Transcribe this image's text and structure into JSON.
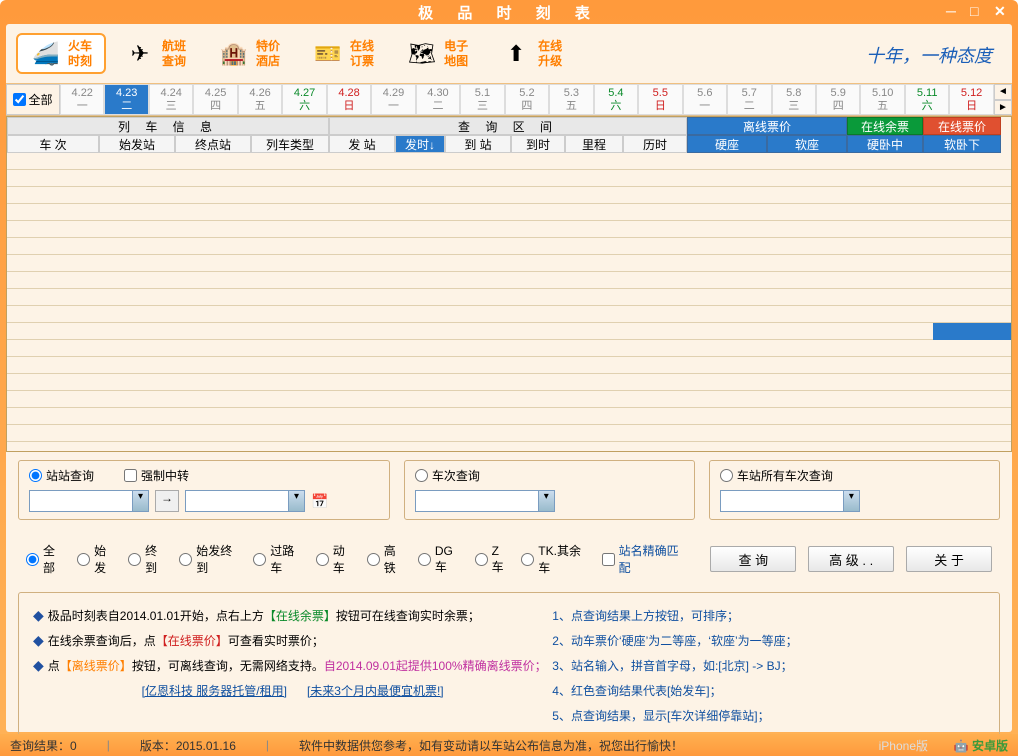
{
  "title": "极 品 时 刻 表",
  "nav": [
    {
      "l1": "火车",
      "l2": "时刻",
      "icon": "🚄"
    },
    {
      "l1": "航班",
      "l2": "查询",
      "icon": "✈"
    },
    {
      "l1": "特价",
      "l2": "酒店",
      "icon": "🏨"
    },
    {
      "l1": "在线",
      "l2": "订票",
      "icon": "🎫"
    },
    {
      "l1": "电子",
      "l2": "地图",
      "icon": "🗺"
    },
    {
      "l1": "在线",
      "l2": "升级",
      "icon": "⬆"
    }
  ],
  "slogan": "十年，一种态度",
  "date_all": "全部",
  "dates": [
    {
      "d": "4.22",
      "w": "一"
    },
    {
      "d": "4.23",
      "w": "二",
      "active": true
    },
    {
      "d": "4.24",
      "w": "三"
    },
    {
      "d": "4.25",
      "w": "四"
    },
    {
      "d": "4.26",
      "w": "五"
    },
    {
      "d": "4.27",
      "w": "六",
      "sat": true
    },
    {
      "d": "4.28",
      "w": "日",
      "sun": true
    },
    {
      "d": "4.29",
      "w": "一"
    },
    {
      "d": "4.30",
      "w": "二"
    },
    {
      "d": "5.1",
      "w": "三"
    },
    {
      "d": "5.2",
      "w": "四"
    },
    {
      "d": "5.3",
      "w": "五"
    },
    {
      "d": "5.4",
      "w": "六",
      "sat": true
    },
    {
      "d": "5.5",
      "w": "日",
      "sun": true
    },
    {
      "d": "5.6",
      "w": "一"
    },
    {
      "d": "5.7",
      "w": "二"
    },
    {
      "d": "5.8",
      "w": "三"
    },
    {
      "d": "5.9",
      "w": "四"
    },
    {
      "d": "5.10",
      "w": "五"
    },
    {
      "d": "5.11",
      "w": "六",
      "sat": true
    },
    {
      "d": "5.12",
      "w": "日",
      "sun": true
    }
  ],
  "hgroup": {
    "a": "列 车 信 息",
    "b": "查 询 区 间",
    "c": "离线票价",
    "d": "在线余票",
    "e": "在线票价"
  },
  "cols": {
    "c1": "车 次",
    "c2": "始发站",
    "c3": "终点站",
    "c4": "列车类型",
    "c5": "发 站",
    "c6": "发时↓",
    "c7": "到 站",
    "c8": "到时",
    "c9": "里程",
    "c10": "历时",
    "c11": "硬座",
    "c12": "软座",
    "c13": "硬卧中",
    "c14": "软卧下"
  },
  "q1": {
    "r1": "站站查询",
    "chk": "强制中转"
  },
  "q2": {
    "r1": "车次查询"
  },
  "q3": {
    "r1": "车站所有车次查询"
  },
  "filters": {
    "all": "全部",
    "sf": "始发",
    "zd": "终到",
    "sfzd": "始发终到",
    "glc": "过路车",
    "dc": "动车",
    "gt": "高铁",
    "dgc": "DG车",
    "zc": "Z车",
    "tk": "TK.其余车",
    "jq": "站名精确匹配"
  },
  "buttons": {
    "query": "查 询",
    "adv": "高 级 . .",
    "about": "关 于"
  },
  "info_left": {
    "l1a": "极品时刻表自2014.01.01开始，点右上方",
    "l1b": "【在线余票】",
    "l1c": "按钮可在线查询实时余票；",
    "l2a": "在线余票查询后，点",
    "l2b": "【在线票价】",
    "l2c": "可查看实时票价；",
    "l3a": "点",
    "l3b": "【离线票价】",
    "l3c": "按钮，可离线查询，无需网络支持。",
    "l3d": "自2014.09.01起提供100%精确离线票价；"
  },
  "info_right": {
    "r1": "1、点查询结果上方按钮，可排序；",
    "r2": "2、动车票价‘硬座’为二等座，‘软座’为一等座；",
    "r3": "3、站名输入，拼音首字母，如:[北京] -> BJ；",
    "r4": "4、红色查询结果代表[始发车]；",
    "r5": "5、点查询结果，显示[车次详细停靠站]；"
  },
  "links": {
    "a": "[亿恩科技 服务器托管/租用]",
    "b": "[未来3个月内最便宜机票!]"
  },
  "status": {
    "res": "查询结果：0",
    "ver": "版本：2015.01.16",
    "note": "软件中数据供您参考，如有变动请以车站公布信息为准，祝您出行愉快！",
    "ios": " iPhone版",
    "android": "安卓版"
  }
}
